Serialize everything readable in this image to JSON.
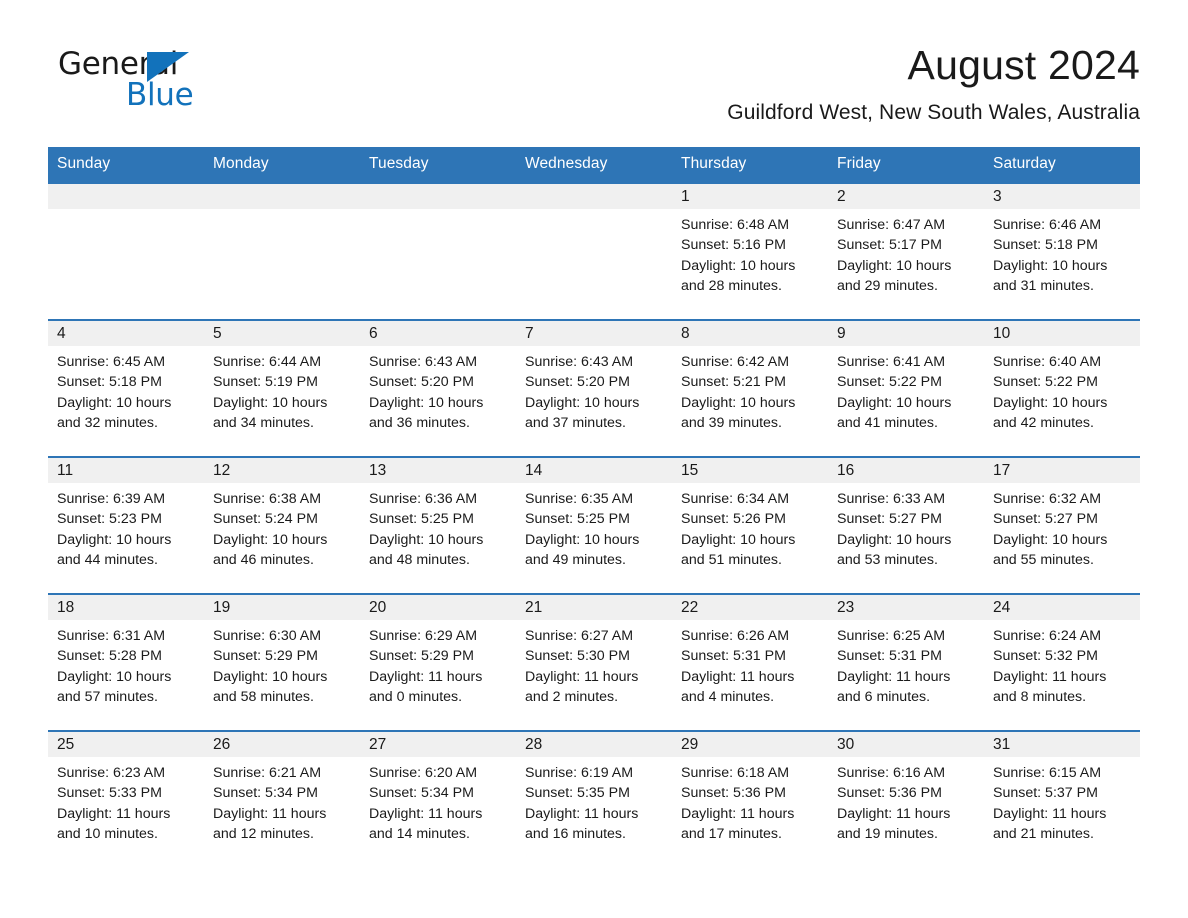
{
  "logo": {
    "word_one": "General",
    "word_two": "Blue",
    "accent_color": "#1272bb",
    "triangle_icon": "triangle-icon"
  },
  "header": {
    "title": "August 2024",
    "location": "Guildford West, New South Wales, Australia"
  },
  "theme": {
    "header_blue": "#2e75b6",
    "daynum_band": "#f0f0f0",
    "text": "#1a1a1a"
  },
  "calendar": {
    "weekday_headers": [
      "Sunday",
      "Monday",
      "Tuesday",
      "Wednesday",
      "Thursday",
      "Friday",
      "Saturday"
    ],
    "weeks": [
      [
        {
          "day": "",
          "lines": []
        },
        {
          "day": "",
          "lines": []
        },
        {
          "day": "",
          "lines": []
        },
        {
          "day": "",
          "lines": []
        },
        {
          "day": "1",
          "lines": [
            "Sunrise: 6:48 AM",
            "Sunset: 5:16 PM",
            "Daylight: 10 hours",
            "and 28 minutes."
          ]
        },
        {
          "day": "2",
          "lines": [
            "Sunrise: 6:47 AM",
            "Sunset: 5:17 PM",
            "Daylight: 10 hours",
            "and 29 minutes."
          ]
        },
        {
          "day": "3",
          "lines": [
            "Sunrise: 6:46 AM",
            "Sunset: 5:18 PM",
            "Daylight: 10 hours",
            "and 31 minutes."
          ]
        }
      ],
      [
        {
          "day": "4",
          "lines": [
            "Sunrise: 6:45 AM",
            "Sunset: 5:18 PM",
            "Daylight: 10 hours",
            "and 32 minutes."
          ]
        },
        {
          "day": "5",
          "lines": [
            "Sunrise: 6:44 AM",
            "Sunset: 5:19 PM",
            "Daylight: 10 hours",
            "and 34 minutes."
          ]
        },
        {
          "day": "6",
          "lines": [
            "Sunrise: 6:43 AM",
            "Sunset: 5:20 PM",
            "Daylight: 10 hours",
            "and 36 minutes."
          ]
        },
        {
          "day": "7",
          "lines": [
            "Sunrise: 6:43 AM",
            "Sunset: 5:20 PM",
            "Daylight: 10 hours",
            "and 37 minutes."
          ]
        },
        {
          "day": "8",
          "lines": [
            "Sunrise: 6:42 AM",
            "Sunset: 5:21 PM",
            "Daylight: 10 hours",
            "and 39 minutes."
          ]
        },
        {
          "day": "9",
          "lines": [
            "Sunrise: 6:41 AM",
            "Sunset: 5:22 PM",
            "Daylight: 10 hours",
            "and 41 minutes."
          ]
        },
        {
          "day": "10",
          "lines": [
            "Sunrise: 6:40 AM",
            "Sunset: 5:22 PM",
            "Daylight: 10 hours",
            "and 42 minutes."
          ]
        }
      ],
      [
        {
          "day": "11",
          "lines": [
            "Sunrise: 6:39 AM",
            "Sunset: 5:23 PM",
            "Daylight: 10 hours",
            "and 44 minutes."
          ]
        },
        {
          "day": "12",
          "lines": [
            "Sunrise: 6:38 AM",
            "Sunset: 5:24 PM",
            "Daylight: 10 hours",
            "and 46 minutes."
          ]
        },
        {
          "day": "13",
          "lines": [
            "Sunrise: 6:36 AM",
            "Sunset: 5:25 PM",
            "Daylight: 10 hours",
            "and 48 minutes."
          ]
        },
        {
          "day": "14",
          "lines": [
            "Sunrise: 6:35 AM",
            "Sunset: 5:25 PM",
            "Daylight: 10 hours",
            "and 49 minutes."
          ]
        },
        {
          "day": "15",
          "lines": [
            "Sunrise: 6:34 AM",
            "Sunset: 5:26 PM",
            "Daylight: 10 hours",
            "and 51 minutes."
          ]
        },
        {
          "day": "16",
          "lines": [
            "Sunrise: 6:33 AM",
            "Sunset: 5:27 PM",
            "Daylight: 10 hours",
            "and 53 minutes."
          ]
        },
        {
          "day": "17",
          "lines": [
            "Sunrise: 6:32 AM",
            "Sunset: 5:27 PM",
            "Daylight: 10 hours",
            "and 55 minutes."
          ]
        }
      ],
      [
        {
          "day": "18",
          "lines": [
            "Sunrise: 6:31 AM",
            "Sunset: 5:28 PM",
            "Daylight: 10 hours",
            "and 57 minutes."
          ]
        },
        {
          "day": "19",
          "lines": [
            "Sunrise: 6:30 AM",
            "Sunset: 5:29 PM",
            "Daylight: 10 hours",
            "and 58 minutes."
          ]
        },
        {
          "day": "20",
          "lines": [
            "Sunrise: 6:29 AM",
            "Sunset: 5:29 PM",
            "Daylight: 11 hours",
            "and 0 minutes."
          ]
        },
        {
          "day": "21",
          "lines": [
            "Sunrise: 6:27 AM",
            "Sunset: 5:30 PM",
            "Daylight: 11 hours",
            "and 2 minutes."
          ]
        },
        {
          "day": "22",
          "lines": [
            "Sunrise: 6:26 AM",
            "Sunset: 5:31 PM",
            "Daylight: 11 hours",
            "and 4 minutes."
          ]
        },
        {
          "day": "23",
          "lines": [
            "Sunrise: 6:25 AM",
            "Sunset: 5:31 PM",
            "Daylight: 11 hours",
            "and 6 minutes."
          ]
        },
        {
          "day": "24",
          "lines": [
            "Sunrise: 6:24 AM",
            "Sunset: 5:32 PM",
            "Daylight: 11 hours",
            "and 8 minutes."
          ]
        }
      ],
      [
        {
          "day": "25",
          "lines": [
            "Sunrise: 6:23 AM",
            "Sunset: 5:33 PM",
            "Daylight: 11 hours",
            "and 10 minutes."
          ]
        },
        {
          "day": "26",
          "lines": [
            "Sunrise: 6:21 AM",
            "Sunset: 5:34 PM",
            "Daylight: 11 hours",
            "and 12 minutes."
          ]
        },
        {
          "day": "27",
          "lines": [
            "Sunrise: 6:20 AM",
            "Sunset: 5:34 PM",
            "Daylight: 11 hours",
            "and 14 minutes."
          ]
        },
        {
          "day": "28",
          "lines": [
            "Sunrise: 6:19 AM",
            "Sunset: 5:35 PM",
            "Daylight: 11 hours",
            "and 16 minutes."
          ]
        },
        {
          "day": "29",
          "lines": [
            "Sunrise: 6:18 AM",
            "Sunset: 5:36 PM",
            "Daylight: 11 hours",
            "and 17 minutes."
          ]
        },
        {
          "day": "30",
          "lines": [
            "Sunrise: 6:16 AM",
            "Sunset: 5:36 PM",
            "Daylight: 11 hours",
            "and 19 minutes."
          ]
        },
        {
          "day": "31",
          "lines": [
            "Sunrise: 6:15 AM",
            "Sunset: 5:37 PM",
            "Daylight: 11 hours",
            "and 21 minutes."
          ]
        }
      ]
    ]
  }
}
